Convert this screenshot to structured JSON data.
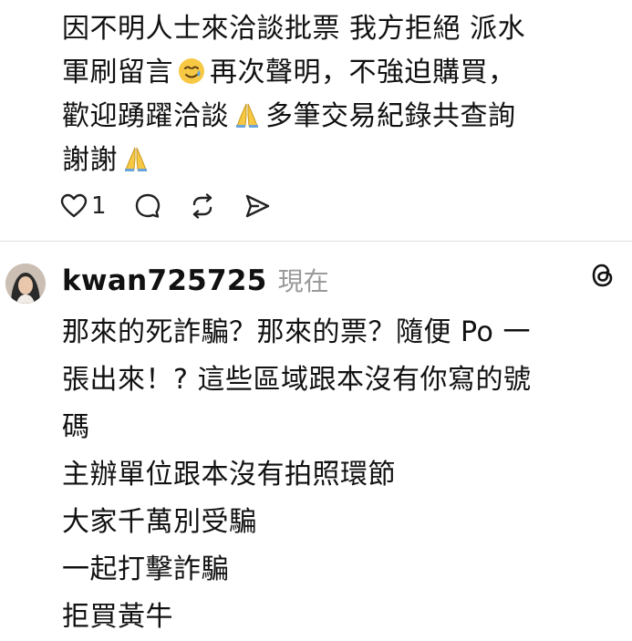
{
  "post": {
    "lines": {
      "l1": "因不明人士來洽談批票 我方拒絕 派水",
      "l2a": "軍刷留言",
      "l2b": "再次聲明，不強迫購買，",
      "l3a": "歡迎踴躍洽談",
      "l3b": "多筆交易紀錄共查詢",
      "l4a": "謝謝"
    },
    "emojis": {
      "smile_tear": "smiling-face-with-tear",
      "pray": "folded-hands"
    },
    "actions": {
      "like_count": "1",
      "like_icon": "heart-icon",
      "comment_icon": "comment-icon",
      "repost_icon": "repost-icon",
      "share_icon": "share-icon"
    }
  },
  "reply": {
    "username": "kwan725725",
    "timestamp": "現在",
    "platform_icon": "threads-icon",
    "lines": {
      "l1": "那來的死詐騙？那來的票？隨便 Po 一",
      "l2": "張出來！? 這些區域跟本沒有你寫的號",
      "l3": "碼",
      "l4": "主辦單位跟本沒有拍照環節",
      "l5": "大家千萬別受騙",
      "l6": "一起打擊詐騙",
      "l7": "拒買黃牛"
    }
  },
  "colors": {
    "text": "#111111",
    "muted": "#9a9a9a",
    "divider": "#e2e2e2",
    "emoji_yellow": "#f7c844"
  }
}
